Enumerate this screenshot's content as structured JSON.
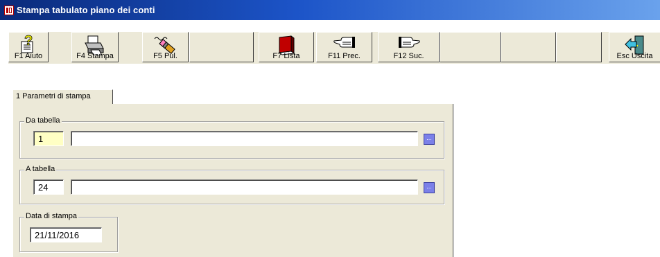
{
  "window": {
    "title": "Stampa tabulato piano dei conti"
  },
  "toolbar": {
    "buttons": [
      {
        "label": "F1 Aiuto",
        "icon": "help-question-icon"
      },
      {
        "label": "F4 Stampa",
        "icon": "printer-icon"
      },
      {
        "label": "F5 Pul.",
        "icon": "eraser-icon"
      },
      {
        "label": "",
        "icon": ""
      },
      {
        "label": "F7 Lista",
        "icon": "book-icon"
      },
      {
        "label": "F11 Prec.",
        "icon": "hand-point-left-icon"
      },
      {
        "label": "F12 Suc.",
        "icon": "hand-point-right-icon"
      },
      {
        "label": "",
        "icon": ""
      },
      {
        "label": "",
        "icon": ""
      },
      {
        "label": "",
        "icon": ""
      },
      {
        "label": "Esc Uscita",
        "icon": "exit-door-icon"
      }
    ]
  },
  "tabs": [
    {
      "label": "1 Parametri di stampa",
      "selected": true
    }
  ],
  "form": {
    "da_tabella": {
      "label": "Da tabella",
      "code": "1",
      "description": ""
    },
    "a_tabella": {
      "label": "A tabella",
      "code": "24",
      "description": ""
    },
    "data_stampa": {
      "label": "Data di stampa",
      "value": "21/11/2016"
    }
  },
  "lookup_button_glyph": "..."
}
